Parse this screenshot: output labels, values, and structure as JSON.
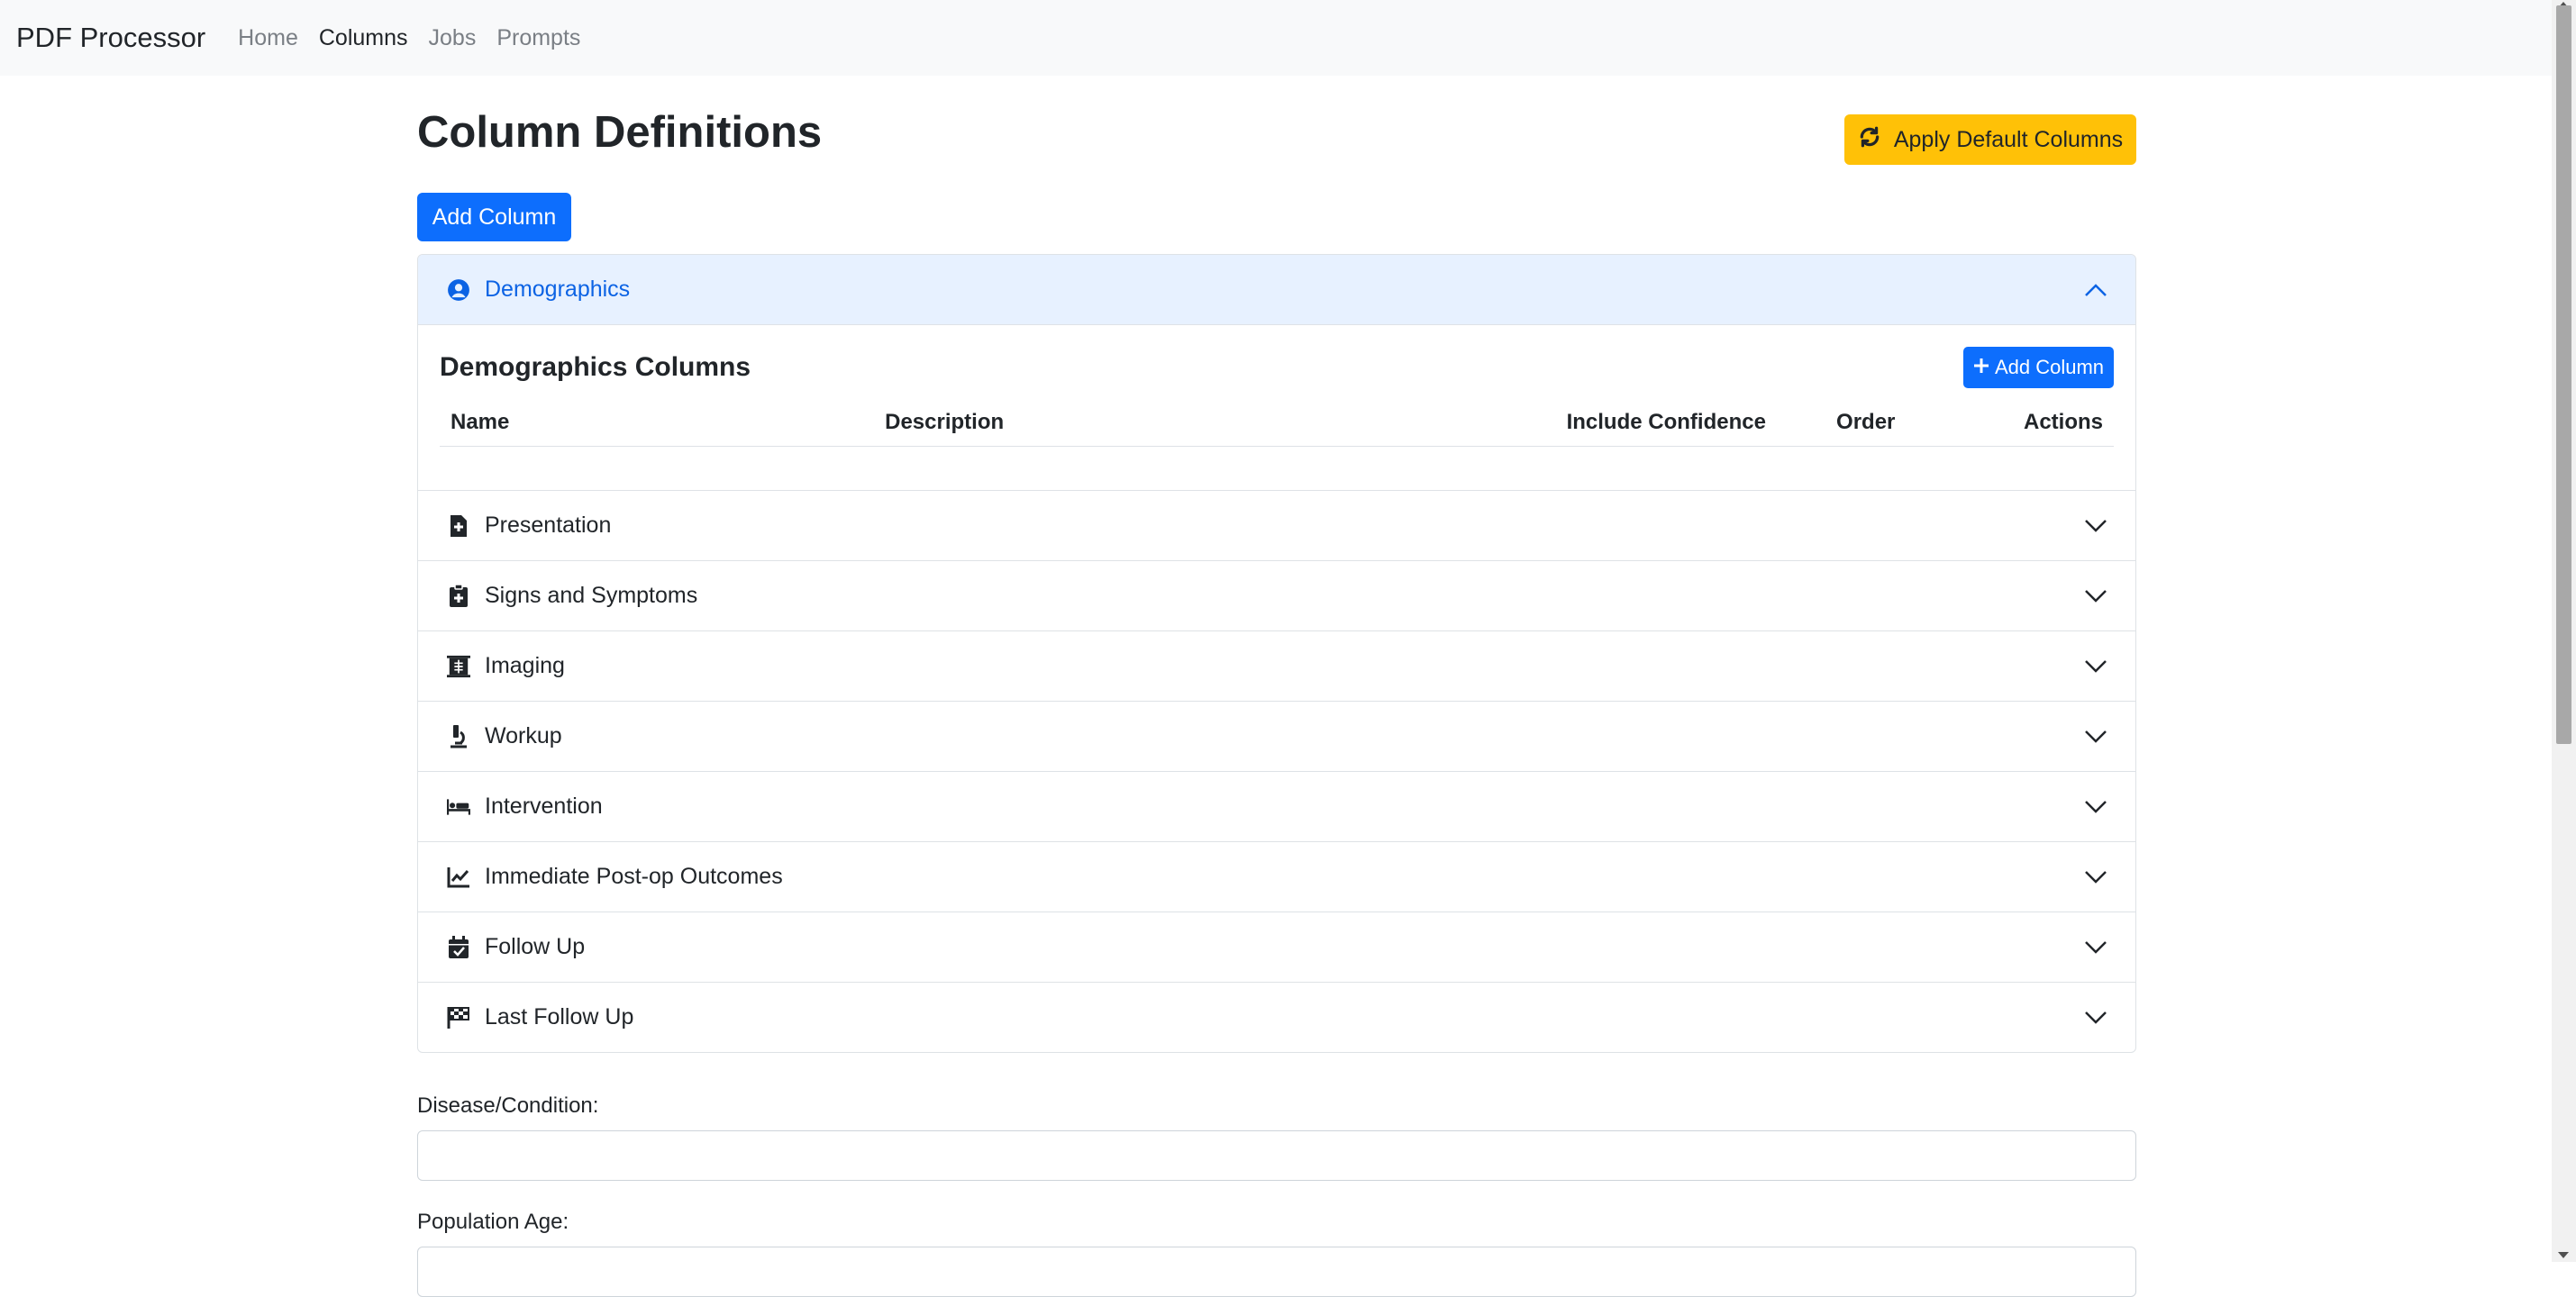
{
  "navbar": {
    "brand": "PDF Processor",
    "links": [
      "Home",
      "Columns",
      "Jobs",
      "Prompts"
    ],
    "active": "Columns"
  },
  "page": {
    "title": "Column Definitions",
    "apply_default_label": "Apply Default Columns",
    "add_column_label": "Add Column"
  },
  "accordion": {
    "open_section": {
      "label": "Demographics",
      "icon": "user-circle-icon",
      "body_title": "Demographics Columns",
      "add_label": "Add Column",
      "table_headers": [
        "Name",
        "Description",
        "Include Confidence",
        "Order",
        "Actions"
      ]
    },
    "sections": [
      {
        "label": "Presentation",
        "icon": "file-medical-icon"
      },
      {
        "label": "Signs and Symptoms",
        "icon": "clipboard-medical-icon"
      },
      {
        "label": "Imaging",
        "icon": "x-ray-icon"
      },
      {
        "label": "Workup",
        "icon": "microscope-icon"
      },
      {
        "label": "Intervention",
        "icon": "procedure-bed-icon"
      },
      {
        "label": "Immediate Post-op Outcomes",
        "icon": "line-chart-icon"
      },
      {
        "label": "Follow Up",
        "icon": "calendar-check-icon"
      },
      {
        "label": "Last Follow Up",
        "icon": "checkered-flag-icon"
      }
    ]
  },
  "form": {
    "disease_label": "Disease/Condition:",
    "disease_value": "",
    "age_label": "Population Age:",
    "age_value": ""
  },
  "colors": {
    "primary": "#0d6efd",
    "warning": "#ffc107",
    "accordion_open_bg": "#e7f1ff",
    "accordion_open_text": "#0c63e4"
  }
}
